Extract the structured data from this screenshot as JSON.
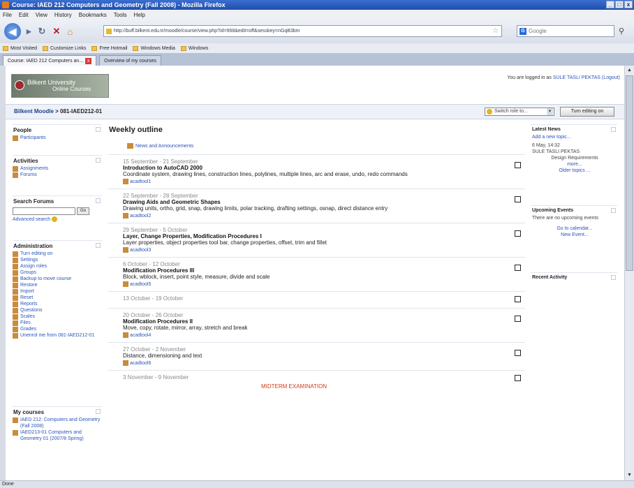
{
  "window": {
    "title": "Course: IAED 212 Computers and Geometry (Fall 2008) - Mozilla Firefox",
    "controls": [
      "_",
      "□",
      "x"
    ]
  },
  "menu": [
    "File",
    "Edit",
    "View",
    "History",
    "Bookmarks",
    "Tools",
    "Help"
  ],
  "nav": {
    "url": "http://buff.bilkent.edu.tr/moodle/course/view.php?id=968&edit=off&sesskey=nGqB3bm",
    "search_placeholder": "Google"
  },
  "bookmarks": [
    "Most Visited",
    "Customize Links",
    "Free Hotmail",
    "Windows Media",
    "Windows"
  ],
  "tabs": [
    {
      "label": "Course: IAED 212 Computers an..."
    },
    {
      "label": "Overview of my courses"
    }
  ],
  "header": {
    "logo_line1": "Bilkent University",
    "logo_line2": "Online Courses",
    "login_prefix": "You are logged in as",
    "user": "SULE TASLI PEKTAS",
    "logout": "(Logout)"
  },
  "breadcrumb": {
    "home": "Bilkent Moodle",
    "sep": " > ",
    "course": "081-IAED212-01"
  },
  "role_select": "Switch role to...",
  "turn_editing": "Turn editing on",
  "left": {
    "people": {
      "title": "People",
      "items": [
        "Participants"
      ]
    },
    "activities": {
      "title": "Activities",
      "items": [
        "Assignments",
        "Forums"
      ]
    },
    "search": {
      "title": "Search Forums",
      "go": "Go",
      "advanced": "Advanced search"
    },
    "admin": {
      "title": "Administration",
      "items": [
        "Turn editing on",
        "Settings",
        "Assign roles",
        "Groups",
        "Backup to move course",
        "Restore",
        "Import",
        "Reset",
        "Reports",
        "Questions",
        "Scales",
        "Files",
        "Grades",
        "Unenrol me from 081-IAED212-01"
      ]
    },
    "mycourses": {
      "title": "My courses",
      "items": [
        "IAED 212: Computers and Geometry (Fall 2008)",
        "IAED213-01 Computers and Geometry 01 (2007/8 Spring)"
      ]
    }
  },
  "main": {
    "title": "Weekly outline",
    "news": "News and Announcements",
    "weeks": [
      {
        "date": "15 September - 21 September",
        "name": "Introduction to AutoCAD 2000",
        "summary": "Coordinate system, drawing lines, construction lines, polylines, multiple lines, arc and erase, undo, redo commands",
        "resource": "acadtool1"
      },
      {
        "date": "22 September - 28 September",
        "name": "Drawing Aids and Geometric Shapes",
        "summary": "Drawing units, ortho, grid, snap, drawing limits, polar tracking, drafting settings, osnap, direct distance entry",
        "resource": "acadtool2"
      },
      {
        "date": "29 September - 5 October",
        "name": "Layer, Change Properties, Modification Procedures I",
        "summary": "Layer properties, object properties tool bar, change properties, offset, trim and fillet",
        "resource": "acadtool3"
      },
      {
        "date": "6 October - 12 October",
        "name": "Modification Procedures III",
        "summary": "Block, wblock, insert, point style, measure, divide and scale",
        "resource": "acadtool5"
      },
      {
        "date": "13 October - 19 October",
        "name": "",
        "summary": "",
        "resource": ""
      },
      {
        "date": "20 October - 26 October",
        "name": "Modification Procedures II",
        "summary": "Move, copy, rotate, mirror, array, stretch and break",
        "resource": "acadtool4"
      },
      {
        "date": "27 October - 2 November",
        "name": "",
        "summary": "Distance, dimensioning and text",
        "resource": "acadtool6"
      },
      {
        "date": "3 November - 9 November",
        "name": "",
        "summary": "",
        "resource": "",
        "note": "MIDTERM EXAMINATION"
      }
    ]
  },
  "right": {
    "news": {
      "title": "Latest News",
      "add": "Add a new topic...",
      "date": "6 May, 14:32",
      "author": "SULE TASLI PEKTAS",
      "item": "Design Requirements",
      "more": "more...",
      "older": "Older topics ..."
    },
    "events": {
      "title": "Upcoming Events",
      "text": "There are no upcoming events",
      "calendar": "Go to calendar...",
      "new": "New Event..."
    },
    "activity": {
      "title": "Recent Activity"
    }
  },
  "status": "Done"
}
